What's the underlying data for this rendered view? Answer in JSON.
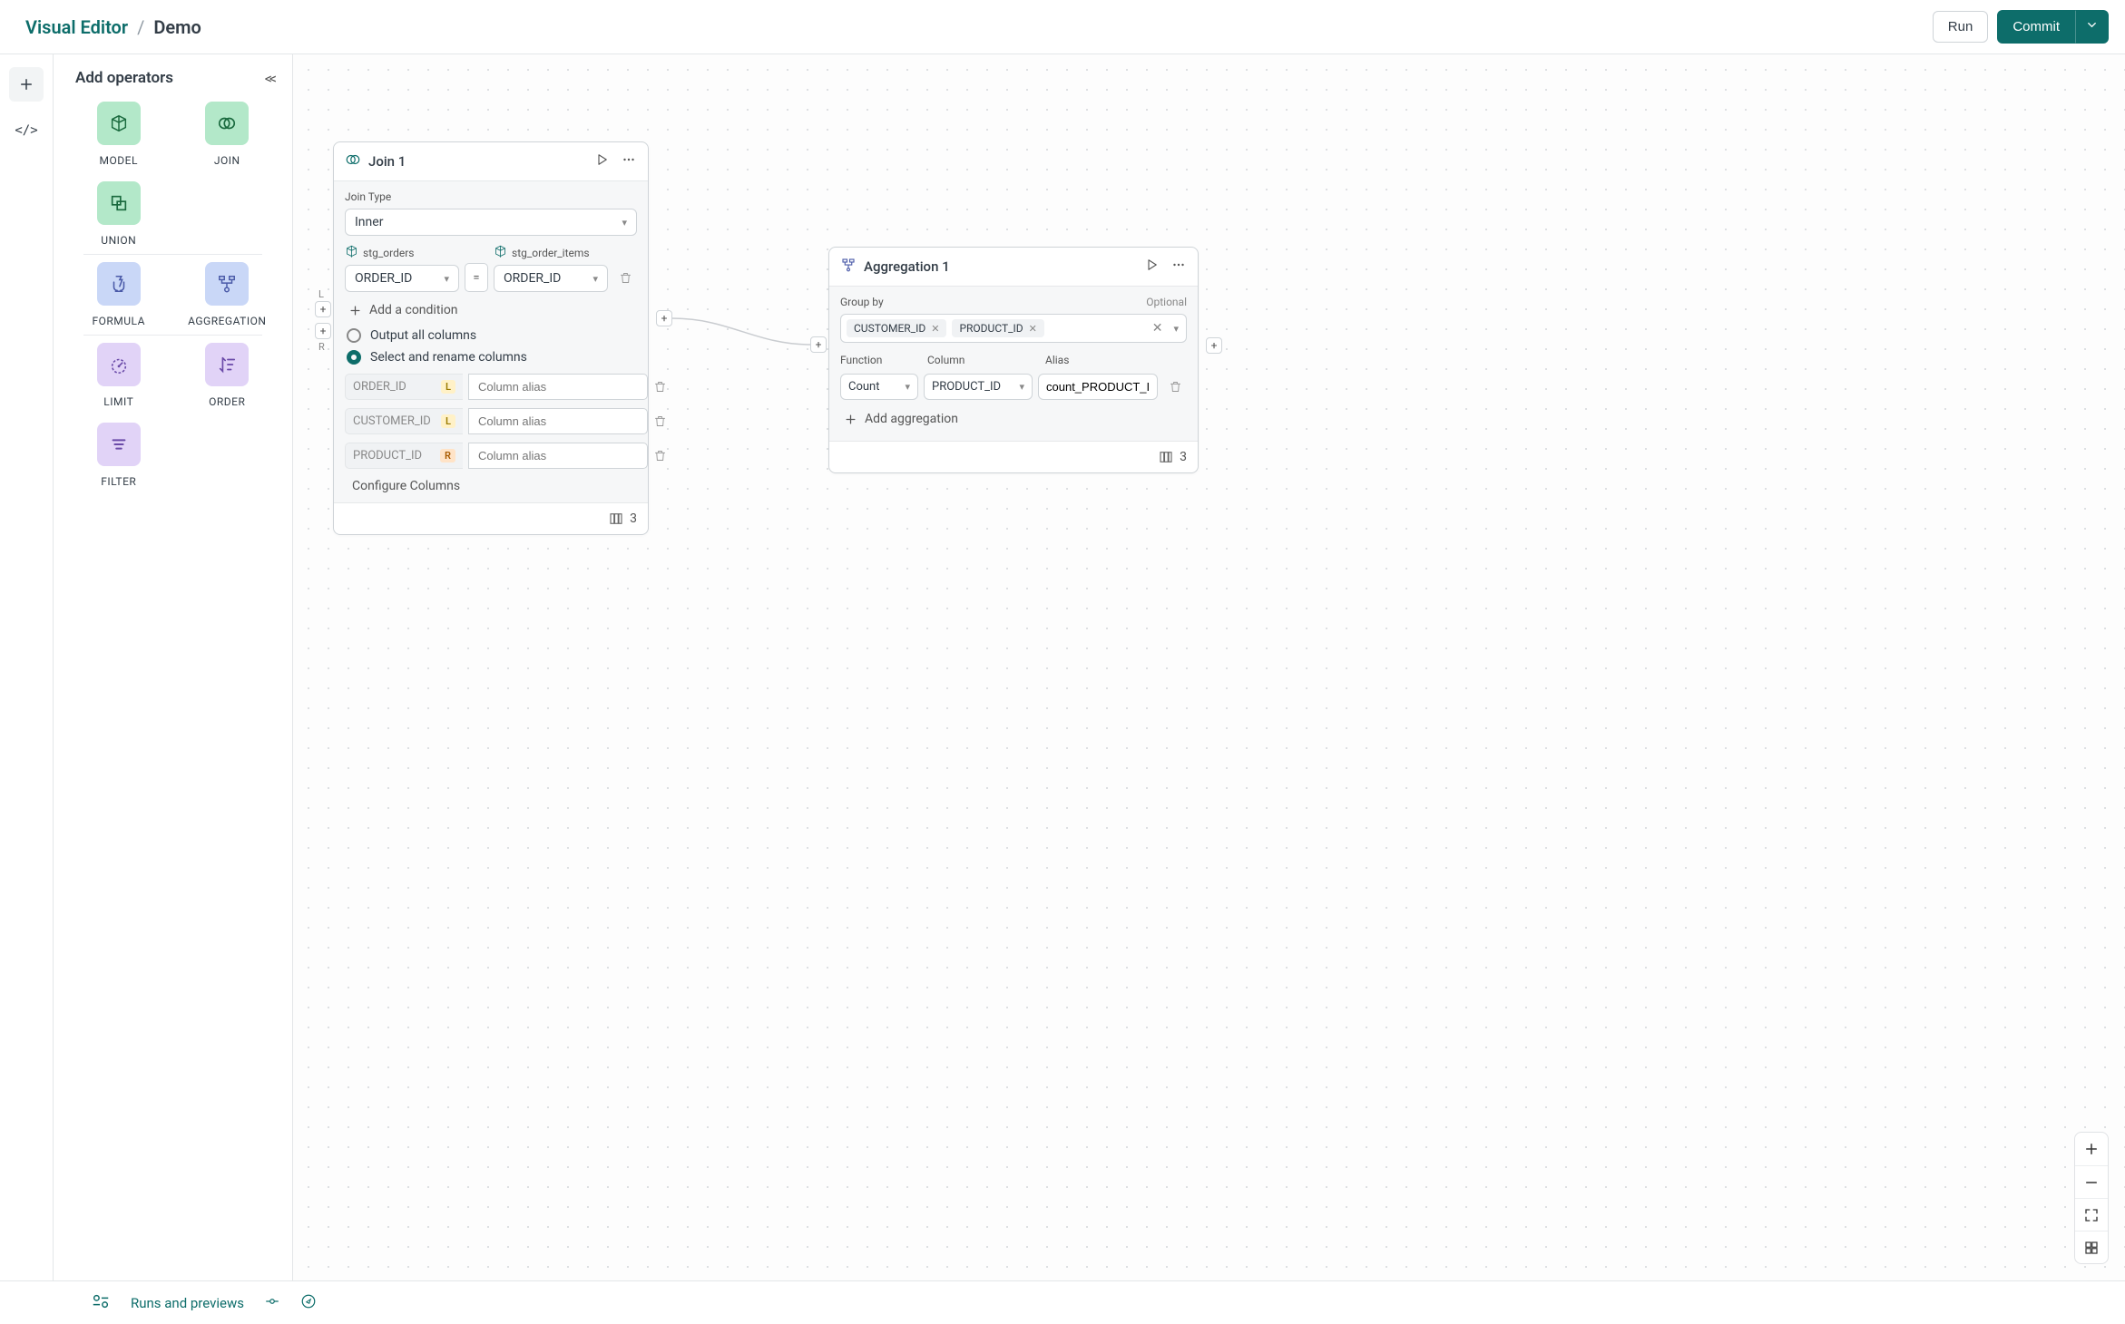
{
  "header": {
    "breadcrumb_app": "Visual Editor",
    "breadcrumb_sep": "/",
    "breadcrumb_page": "Demo",
    "run_label": "Run",
    "commit_label": "Commit"
  },
  "sidebar": {
    "title": "Add operators",
    "operators_section1": [
      {
        "key": "model",
        "label": "MODEL",
        "color": "green"
      },
      {
        "key": "join",
        "label": "JOIN",
        "color": "green"
      },
      {
        "key": "union",
        "label": "UNION",
        "color": "green"
      }
    ],
    "operators_section2": [
      {
        "key": "formula",
        "label": "FORMULA",
        "color": "blue"
      },
      {
        "key": "aggregation",
        "label": "AGGREGATION",
        "color": "blue"
      }
    ],
    "operators_section3": [
      {
        "key": "limit",
        "label": "LIMIT",
        "color": "purple"
      },
      {
        "key": "order",
        "label": "ORDER",
        "color": "purple"
      },
      {
        "key": "filter",
        "label": "FILTER",
        "color": "purple"
      }
    ]
  },
  "join_node": {
    "title": "Join 1",
    "join_type_label": "Join Type",
    "join_type_value": "Inner",
    "left_source": "stg_orders",
    "right_source": "stg_order_items",
    "left_column": "ORDER_ID",
    "right_column": "ORDER_ID",
    "eq_symbol": "=",
    "add_condition_label": "Add a condition",
    "output_all_label": "Output all columns",
    "select_rename_label": "Select and rename columns",
    "column_alias_placeholder": "Column alias",
    "columns": [
      {
        "name": "ORDER_ID",
        "side": "L"
      },
      {
        "name": "CUSTOMER_ID",
        "side": "L"
      },
      {
        "name": "PRODUCT_ID",
        "side": "R"
      }
    ],
    "configure_label": "Configure Columns",
    "footer_count": "3",
    "port_left_label": "L",
    "port_right_label": "R"
  },
  "agg_node": {
    "title": "Aggregation 1",
    "group_by_label": "Group by",
    "optional_label": "Optional",
    "group_by_chips": [
      "CUSTOMER_ID",
      "PRODUCT_ID"
    ],
    "col_function": "Function",
    "col_column": "Column",
    "col_alias": "Alias",
    "function_value": "Count",
    "column_value": "PRODUCT_ID",
    "alias_value": "count_PRODUCT_ID",
    "add_agg_label": "Add aggregation",
    "footer_count": "3"
  },
  "bottom_bar": {
    "runs_label": "Runs and previews"
  }
}
